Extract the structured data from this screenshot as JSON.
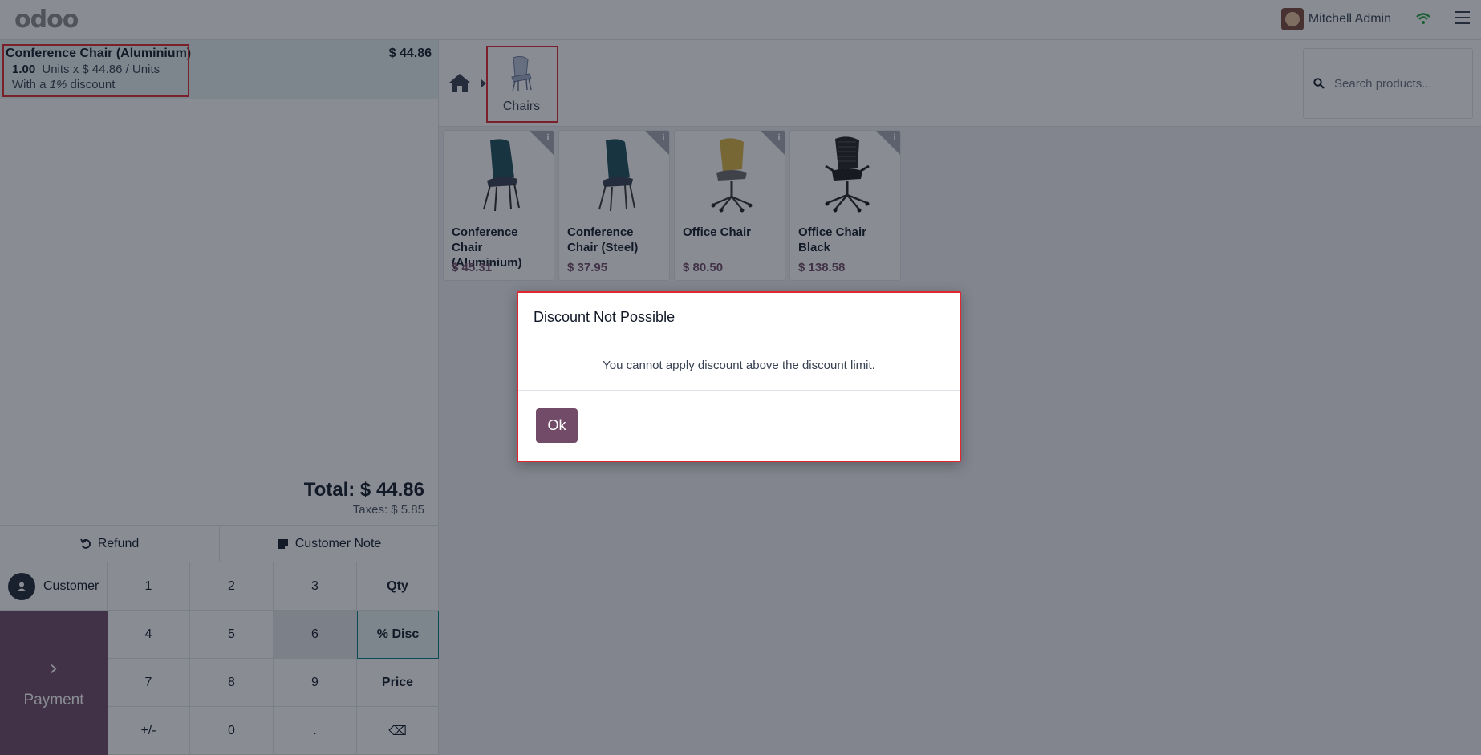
{
  "navbar": {
    "brand": "odoo",
    "user_name": "Mitchell Admin"
  },
  "order": {
    "line": {
      "product": "Conference Chair (Aluminium)",
      "price": "$ 44.86",
      "qty": "1.00",
      "unit_text": "Units x $ 44.86 / Units",
      "discount_prefix": "With a",
      "discount_value": "1%",
      "discount_suffix": "discount"
    },
    "total": "Total: $ 44.86",
    "taxes": "Taxes: $ 5.85"
  },
  "actions": {
    "refund": "Refund",
    "customer_note": "Customer Note"
  },
  "pad": {
    "customer": "Customer",
    "payment": "Payment",
    "keys": [
      "1",
      "2",
      "3",
      "Qty",
      "4",
      "5",
      "6",
      "% Disc",
      "7",
      "8",
      "9",
      "Price",
      "+/-",
      "0",
      ".",
      "⌫"
    ]
  },
  "category": {
    "label": "Chairs"
  },
  "search": {
    "placeholder": "Search products..."
  },
  "products": [
    {
      "name": "Conference Chair (Aluminium)",
      "price": "$ 45.31",
      "color": "#1f4e5a"
    },
    {
      "name": "Conference Chair (Steel)",
      "price": "$ 37.95",
      "color": "#1f4e5a"
    },
    {
      "name": "Office Chair",
      "price": "$ 80.50",
      "color": "#d9b441"
    },
    {
      "name": "Office Chair Black",
      "price": "$ 138.58",
      "color": "#222222"
    }
  ],
  "dialog": {
    "title": "Discount Not Possible",
    "body": "You cannot apply discount above the discount limit.",
    "ok": "Ok"
  },
  "colors": {
    "brand": "#714b67",
    "highlight": "#e0262f",
    "selected_line": "#e6f2f3"
  }
}
